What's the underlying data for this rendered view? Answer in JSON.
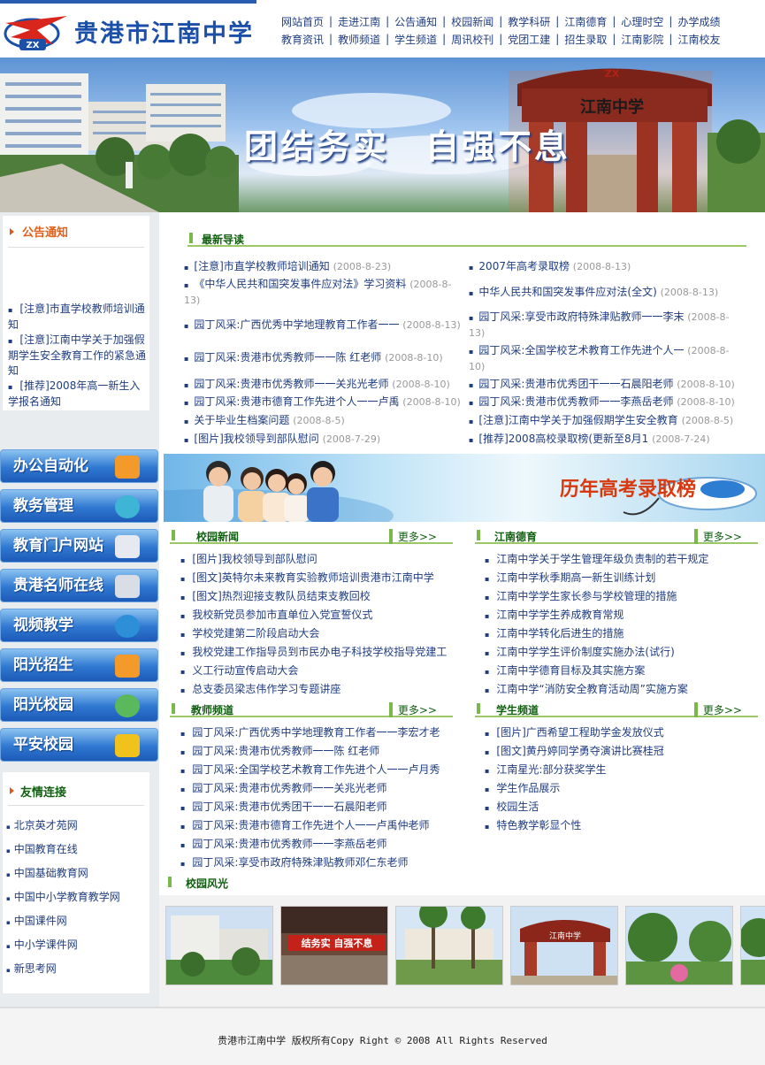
{
  "header": {
    "logo_text": "贵港市江南中学",
    "logo_badge": "ZX",
    "nav_row1": [
      "网站首页",
      "走进江南",
      "公告通知",
      "校园新闻",
      "教学科研",
      "江南德育",
      "心理时空",
      "办学成绩"
    ],
    "nav_row2": [
      "教育资讯",
      "教师频道",
      "学生频道",
      "周讯校刊",
      "党团工建",
      "招生录取",
      "江南影院",
      "江南校友"
    ]
  },
  "banner": {
    "slogan": "团结务实　自强不息",
    "gate_sign": "江南中学",
    "gate_badge": "ZX"
  },
  "notice": {
    "title": "公告通知",
    "items": [
      "[注意]市直学校教师培训通知",
      "[注意]江南中学关于加强假期学生安全教育工作的紧急通知",
      "[推荐]2008年高一新生入学报名通知"
    ]
  },
  "side_buttons": [
    "办公自动化",
    "教务管理",
    "教育门户网站",
    "贵港名师在线",
    "视频教学",
    "阳光招生",
    "阳光校园",
    "平安校园"
  ],
  "friends": {
    "title": "友情连接",
    "items": [
      "北京英才苑网",
      "中国教育在线",
      "中国基础教育网",
      "中国中小学教育教学网",
      "中国课件网",
      "中小学课件网",
      "新思考网"
    ]
  },
  "latest": {
    "title": "最新导读",
    "left": [
      {
        "text": "[注意]市直学校教师培训通知",
        "date": "(2008-8-23)"
      },
      {
        "text": "《中华人民共和国突发事件应对法》学习资料",
        "date": "(2008-8-13)"
      },
      {
        "text": "园丁风采:广西优秀中学地理教育工作者一一",
        "date": "(2008-8-13)"
      },
      {
        "text": "园丁风采:贵港市优秀教师一一陈  红老师",
        "date": "(2008-8-10)"
      },
      {
        "text": "园丁风采:贵港市优秀教师一一关兆光老师",
        "date": "(2008-8-10)"
      },
      {
        "text": "园丁风采:贵港市德育工作先进个人一一卢禹",
        "date": "(2008-8-10)"
      },
      {
        "text": "关于毕业生档案问题",
        "date": "(2008-8-5)"
      },
      {
        "text": "[图片]我校领导到部队慰问",
        "date": "(2008-7-29)"
      }
    ],
    "right": [
      {
        "text": "2007年高考录取榜",
        "date": "(2008-8-13)"
      },
      {
        "text": "中华人民共和国突发事件应对法(全文)",
        "date": "(2008-8-13)"
      },
      {
        "text": "园丁风采:享受市政府特殊津贴教师一一李末",
        "date": "(2008-8-13)"
      },
      {
        "text": "园丁风采:全国学校艺术教育工作先进个人一",
        "date": "(2008-8-10)"
      },
      {
        "text": "园丁风采:贵港市优秀团干一一石晨阳老师",
        "date": "(2008-8-10)"
      },
      {
        "text": "园丁风采:贵港市优秀教师一一李燕岳老师",
        "date": "(2008-8-10)"
      },
      {
        "text": "[注意]江南中学关于加强假期学生安全教育",
        "date": "(2008-8-5)"
      },
      {
        "text": "[推荐]2008高校录取榜(更新至8月1",
        "date": "(2008-7-24)"
      }
    ]
  },
  "ad": {
    "title": "历年高考录取榜"
  },
  "more_label": "更多>>",
  "school_news": {
    "title": "校园新闻",
    "items": [
      "[图片]我校领导到部队慰问",
      "[图文]英特尔未来教育实验教师培训贵港市江南中学",
      "[图文]热烈迎接支教队员结束支教回校",
      "我校新党员参加市直单位入党宣誓仪式",
      "学校党建第二阶段启动大会",
      "我校党建工作指导员到市民办电子科技学校指导党建工",
      "义工行动宣传启动大会",
      "总支委员梁志伟作学习专题讲座"
    ]
  },
  "moral": {
    "title": "江南德育",
    "items": [
      "江南中学关于学生管理年级负责制的若干规定",
      "江南中学秋季期高一新生训练计划",
      "江南中学学生家长参与学校管理的措施",
      "江南中学学生养成教育常规",
      "江南中学转化后进生的措施",
      "江南中学学生评价制度实施办法(试行)",
      "江南中学德育目标及其实施方案",
      "江南中学“消防安全教育活动周”实施方案"
    ]
  },
  "teachers": {
    "title": "教师频道",
    "items": [
      "园丁风采:广西优秀中学地理教育工作者一一李宏才老",
      "园丁风采:贵港市优秀教师一一陈  红老师",
      "园丁风采:全国学校艺术教育工作先进个人一一卢月秀",
      "园丁风采:贵港市优秀教师一一关兆光老师",
      "园丁风采:贵港市优秀团干一一石晨阳老师",
      "园丁风采:贵港市德育工作先进个人一一卢禹仲老师",
      "园丁风采:贵港市优秀教师一一李燕岳老师",
      "园丁风采:享受市政府特殊津贴教师邓仁东老师"
    ]
  },
  "students": {
    "title": "学生频道",
    "items": [
      "[图片]广西希望工程助学金发放仪式",
      "[图文]黄丹婷同学勇夺演讲比赛桂冠",
      "江南星光:部分获奖学生",
      "学生作品展示",
      "校园生活",
      "特色教学彰显个性"
    ]
  },
  "campus": {
    "title": "校园风光",
    "photo2_sign": "结务实 自强不息",
    "photo4_sign": "江南中学"
  },
  "footer": {
    "text": "贵港市江南中学 版权所有Copy Right © 2008 All Rights Reserved"
  }
}
